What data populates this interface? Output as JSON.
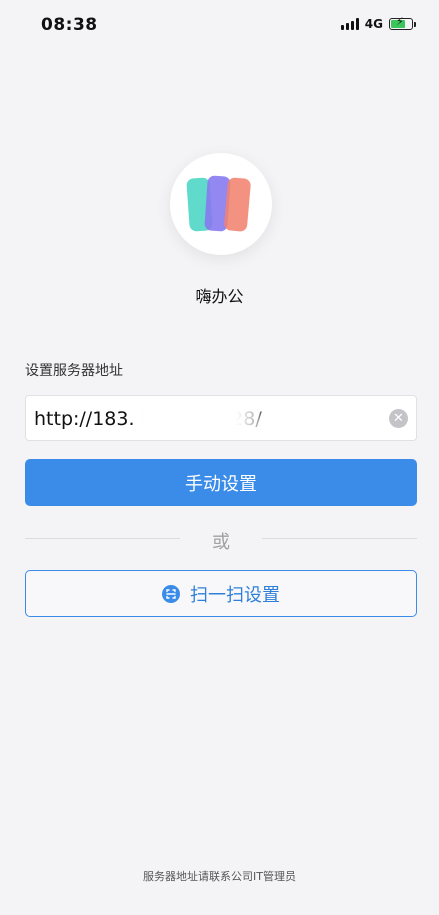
{
  "status_bar": {
    "time": "08:38",
    "network": "4G",
    "battery_color": "#3ac65a",
    "icons": [
      "signal-icon",
      "battery-charging-icon"
    ]
  },
  "app": {
    "name": "嗨办公",
    "logo_colors": [
      "#4fd6c6",
      "#7b6cf0",
      "#f07560"
    ]
  },
  "server": {
    "label": "设置服务器地址",
    "url_value": "http://183.        12 3 28/",
    "clear_icon": "clear-icon"
  },
  "buttons": {
    "manual_label": "手动设置",
    "divider_text": "或",
    "scan_label": "扫一扫设置",
    "scan_icon": "scan-icon"
  },
  "footer": {
    "note": "服务器地址请联系公司IT管理员"
  },
  "colors": {
    "accent": "#3b8ce8",
    "background": "#f4f4f6"
  }
}
